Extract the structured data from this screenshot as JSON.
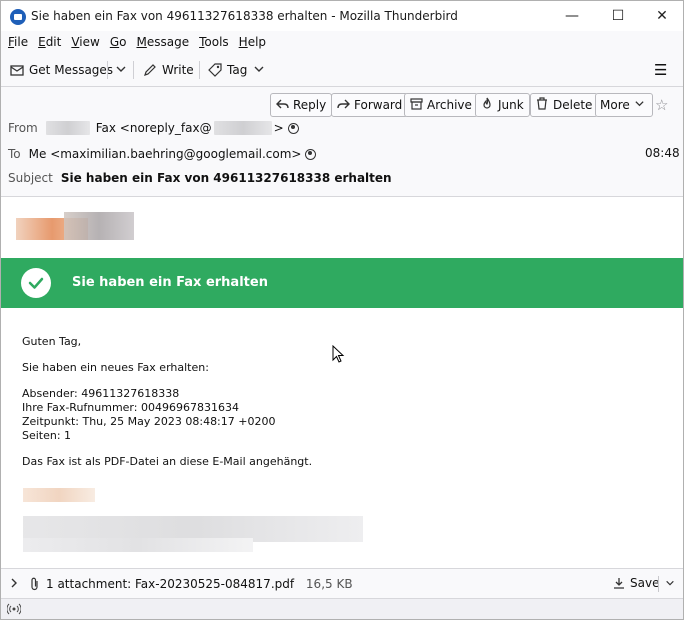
{
  "window": {
    "title": "Sie haben ein Fax von 49611327618338 erhalten - Mozilla Thunderbird",
    "minimize": "—",
    "maximize": "☐",
    "close": "✕"
  },
  "menu": [
    "File",
    "Edit",
    "View",
    "Go",
    "Message",
    "Tools",
    "Help"
  ],
  "toolbar": {
    "get_messages": "Get Messages",
    "write": "Write",
    "tag": "Tag",
    "hamburger": "☰"
  },
  "header": {
    "buttons": {
      "reply": "Reply",
      "forward": "Forward",
      "archive": "Archive",
      "junk": "Junk",
      "delete": "Delete",
      "more": "More"
    },
    "from_label": "From",
    "from_name_suffix": "Fax <noreply_fax@",
    "from_end": ">",
    "to_label": "To",
    "to_value": "Me <maximilian.baehring@googlemail.com>",
    "time": "08:48",
    "subject_label": "Subject",
    "subject_value": "Sie haben ein Fax von 49611327618338 erhalten"
  },
  "body": {
    "banner": "Sie haben ein Fax erhalten",
    "greeting": "Guten Tag,",
    "intro": "Sie haben ein neues Fax erhalten:",
    "sender": "Absender: 49611327618338",
    "fax_number": "Ihre Fax-Rufnummer: 00496967831634",
    "timestamp": "Zeitpunkt: Thu, 25 May 2023 08:48:17 +0200",
    "pages": "Seiten: 1",
    "note": "Das Fax ist als PDF-Datei an diese E-Mail angehängt."
  },
  "attachment": {
    "summary": "1 attachment: Fax-20230525-084817.pdf",
    "size": "16,5 KB",
    "save": "Save"
  },
  "colors": {
    "banner_green": "#2faa60",
    "thunderbird_blue": "#1f5fb8"
  }
}
